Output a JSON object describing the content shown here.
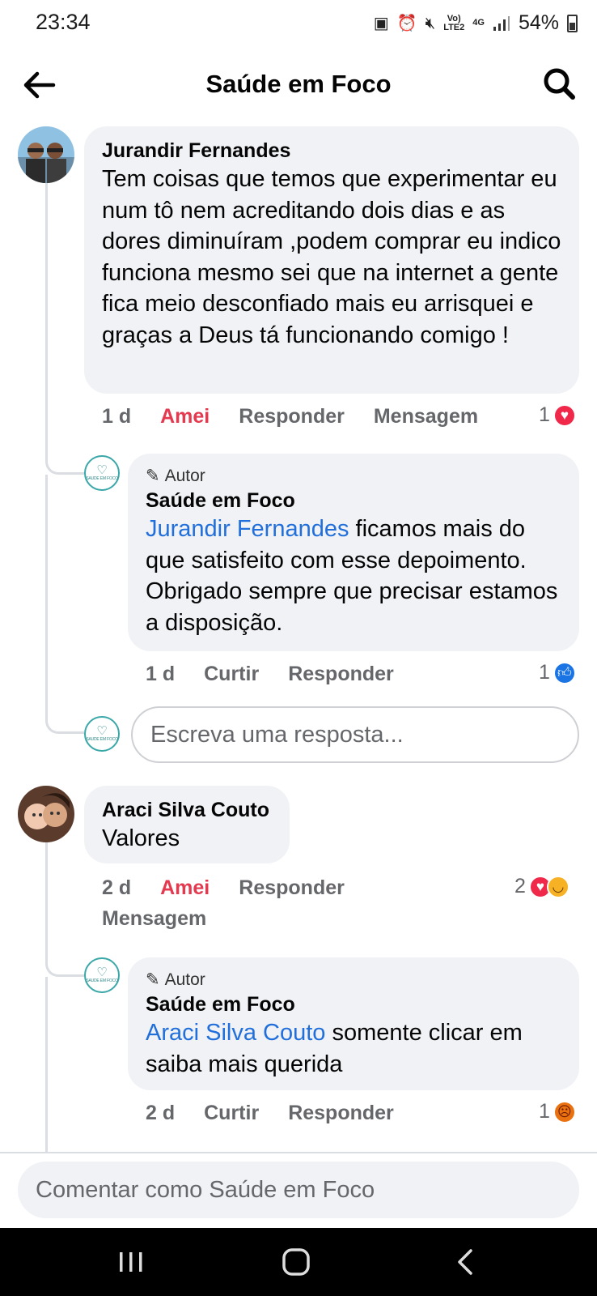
{
  "status_bar": {
    "time": "23:34",
    "icons": [
      "notification-icon",
      "alarm-icon",
      "mute-icon",
      "volte-icon",
      "4g-icon",
      "signal-icon"
    ],
    "volte_label": "Vo)\nLTE2",
    "net_label": "4G",
    "battery_percent": "54%"
  },
  "header": {
    "title": "Saúde em Foco",
    "back_icon": "back-arrow-icon",
    "search_icon": "search-icon"
  },
  "comments": [
    {
      "author": "Jurandir Fernandes",
      "text": "Tem coisas que temos que experimentar eu num tô nem acreditando dois dias e as dores diminuíram ,podem comprar eu indico funciona mesmo sei que na internet a gente fica meio desconfiado mais eu arrisquei e graças a Deus tá funcionando comigo !",
      "time": "1 d",
      "reaction_action": "Amei",
      "reply_action": "Responder",
      "message_action": "Mensagem",
      "reaction_count": "1",
      "reply": {
        "badge": "Autor",
        "author": "Saúde em Foco",
        "mention": "Jurandir Fernandes",
        "text": " ficamos mais do que satisfeito com esse depoimento. Obrigado sempre que precisar estamos a disposição.",
        "time": "1 d",
        "like_action": "Curtir",
        "reply_action": "Responder",
        "reaction_count": "1"
      },
      "reply_placeholder": "Escreva uma resposta..."
    },
    {
      "author": "Araci Silva Couto",
      "text": "Valores",
      "time": "2 d",
      "reaction_action": "Amei",
      "reply_action": "Responder",
      "message_action": "Mensagem",
      "reaction_count": "2",
      "reply": {
        "badge": "Autor",
        "author": "Saúde em Foco",
        "mention": "Araci Silva Couto",
        "text": " somente clicar em saiba mais querida",
        "time": "2 d",
        "like_action": "Curtir",
        "reply_action": "Responder",
        "reaction_count": "1"
      }
    }
  ],
  "composer": {
    "placeholder": "Comentar como Saúde em Foco"
  },
  "colors": {
    "bubble": "#f0f2f5",
    "mention": "#216fdb",
    "loved": "#e4394f",
    "action": "#65676b"
  }
}
